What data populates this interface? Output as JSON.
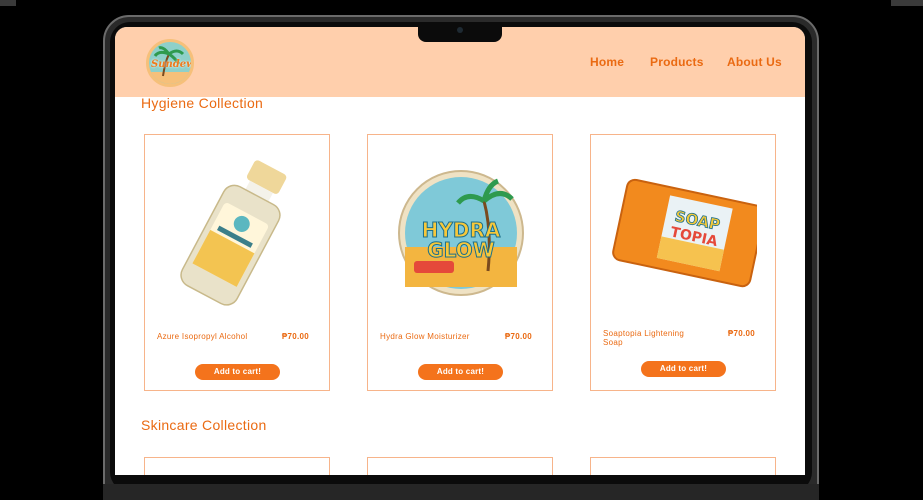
{
  "brand": {
    "logo_text": "Sundew"
  },
  "nav": {
    "links": [
      "Home",
      "Products",
      "About Us"
    ]
  },
  "sections": {
    "hygiene": {
      "title": "Hygiene Collection",
      "products": [
        {
          "name": "Azure Isopropyl Alcohol",
          "price": "₱70.00",
          "button": "Add to cart!",
          "icon": "alcohol-bottle-image"
        },
        {
          "name": "Hydra Glow Moisturizer",
          "price": "₱70.00",
          "button": "Add to cart!",
          "icon": "moisturizer-jar-image",
          "label": "HYDRA GLOW"
        },
        {
          "name": "Soaptopia Lightening Soap",
          "price": "₱70.00",
          "button": "Add to cart!",
          "icon": "soap-bar-image",
          "label": "SOAP TOPIA"
        }
      ]
    },
    "skincare": {
      "title": "Skincare Collection"
    }
  },
  "colors": {
    "accent": "#ea6a12",
    "button": "#f4731c",
    "nav_bg": "#ffcfac",
    "card_border": "#f7b48a"
  }
}
